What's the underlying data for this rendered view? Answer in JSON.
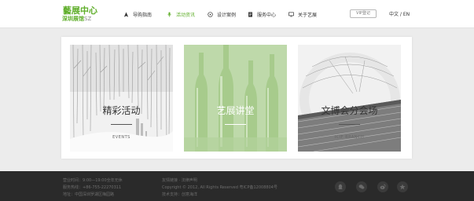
{
  "logo": {
    "line1": "藝展中心",
    "line2": "深圳展馆",
    "line2_sub": "SZ"
  },
  "nav": [
    {
      "label": "导购指南",
      "icon": "location-arrow-icon"
    },
    {
      "label": "活动资讯",
      "icon": "microphone-icon",
      "active": true
    },
    {
      "label": "设计案例",
      "icon": "dashboard-icon"
    },
    {
      "label": "服务中心",
      "icon": "document-icon"
    },
    {
      "label": "关于艺展",
      "icon": "monitor-icon"
    }
  ],
  "vip_label": "VIP登记",
  "language": "中文 / EN",
  "cards": [
    {
      "title": "精彩活动",
      "subtitle": "EVENTS"
    },
    {
      "title": "艺展讲堂",
      "subtitle": ""
    },
    {
      "title": "文博会分会场",
      "subtitle": "ICIF BRANCH"
    }
  ],
  "footer": {
    "col1": [
      "营业时间：9:00—19:00全年无休",
      "服务热线：+86-755-22270311",
      "地址：中国深圳罗湖区梅园路"
    ],
    "col2": [
      "友情链接 · 法律声明",
      "Copyright © 2012, All Rights Reserved 粤ICP备12008804号",
      "技术支持：创意海洋"
    ],
    "social_icons": [
      "qq-icon",
      "wechat-icon",
      "weibo-icon",
      "star-icon"
    ]
  },
  "colors": {
    "accent": "#5fae2a",
    "footer_bg": "#2a2a2a"
  }
}
